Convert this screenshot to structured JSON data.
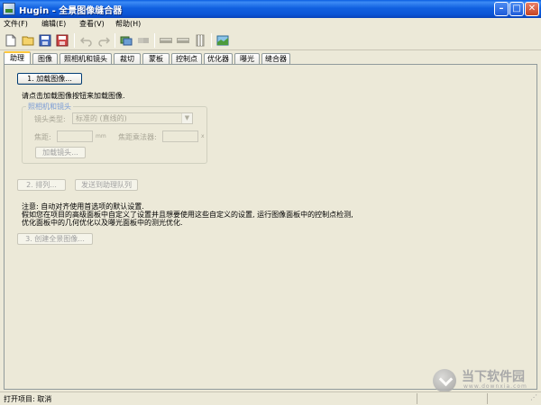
{
  "window": {
    "title": "Hugin - 全景图像缝合器",
    "colors": {
      "titlebar": "#0b55d6",
      "close": "#c44423",
      "tab_highlight": "#ffc83c"
    }
  },
  "menu": [
    {
      "label": "文件",
      "key": "(F)"
    },
    {
      "label": "编辑",
      "key": "(E)"
    },
    {
      "label": "查看",
      "key": "(V)"
    },
    {
      "label": "帮助",
      "key": "(H)"
    }
  ],
  "toolbar": {
    "icons": [
      "new-icon",
      "open-icon",
      "save-icon",
      "save-as-icon",
      "undo-icon",
      "redo-icon",
      "add-images-icon",
      "optimize-icon",
      "preview-icon",
      "stitch-icon",
      "layout-icon",
      "fast-preview-icon"
    ]
  },
  "tabs": [
    "助理",
    "图像",
    "照相机和镜头",
    "裁切",
    "蒙板",
    "控制点",
    "优化器",
    "曝光",
    "缝合器"
  ],
  "assistant": {
    "load_images_button": "1. 加载图像...",
    "hint": "请点击加载图像按钮来加载图像.",
    "camera_group": {
      "legend": "照相机和镜头",
      "lens_type_label": "镜头类型:",
      "lens_type_value": "标准的 (直线的)",
      "focal_length_label": "焦距:",
      "focal_length_unit": "mm",
      "crop_factor_label": "焦距乘法器:",
      "crop_factor_unit": "x",
      "load_lens_button": "加载镜头..."
    },
    "align_button": "2. 排列...",
    "send_to_queue_button": "发送到助理队列",
    "note_lines": [
      "注意: 自动对齐使用首选项的默认设置.",
      "假如您在项目的高级面板中自定义了设置并且想要使用这些自定义的设置, 运行图像面板中的控制点检测,",
      "优化面板中的几何优化以及曝光面板中的测光优化."
    ],
    "create_panorama_button": "3. 创建全景图像..."
  },
  "status": {
    "left": "打开项目: 取消"
  },
  "watermark": {
    "text": "当下软件园",
    "sub": "www.downxia.com"
  }
}
